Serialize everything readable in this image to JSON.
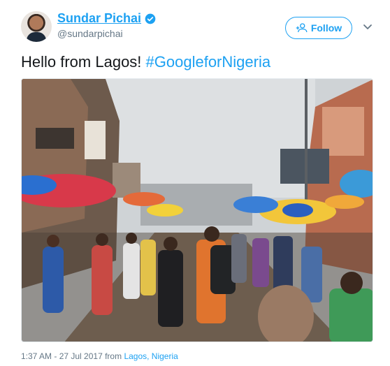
{
  "user": {
    "display_name": "Sundar Pichai",
    "handle": "@sundarpichai",
    "verified": true
  },
  "follow_button": {
    "label": "Follow",
    "icon": "add-user-icon"
  },
  "menu_icon": "chevron-down-icon",
  "tweet": {
    "text": "Hello from Lagos! ",
    "hashtag": "#GoogleforNigeria"
  },
  "photo": {
    "content": "street-market-crowd-photo"
  },
  "meta": {
    "timestamp": "1:37 AM - 27 Jul 2017",
    "from_label": "from",
    "location": "Lagos, Nigeria"
  },
  "colors": {
    "link": "#1da1f2",
    "text": "#14171a",
    "muted": "#657786"
  }
}
